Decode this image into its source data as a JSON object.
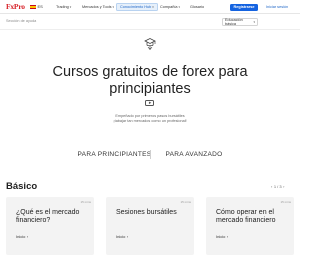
{
  "nav": {
    "logo": "FxPro",
    "lang": "ES",
    "items": [
      {
        "label": "Trading",
        "dropdown": true
      },
      {
        "label": "Mercados y Tools",
        "dropdown": true
      },
      {
        "label": "Conocimiento Hub",
        "dropdown": true,
        "active": true
      },
      {
        "label": "Compañía",
        "dropdown": true
      },
      {
        "label": "Glosario",
        "dropdown": false
      }
    ],
    "register": "Registrarse",
    "login": "Iniciar sesión"
  },
  "search": {
    "placeholder": "Sección de ayuda",
    "select_value": "Educación básica"
  },
  "hero": {
    "title_line1": "Cursos gratuitos de forex para",
    "title_line2": "principiantes",
    "subtitle_line1": "Empeñado por primeros pasos bursátiles",
    "subtitle_line2": "¡tabajar tan mercados como un profesional!"
  },
  "tabs": [
    "PARA PRINCIPIANTES",
    "PARA AVANZADO"
  ],
  "section": {
    "title": "Básico",
    "pager": "1 / 3"
  },
  "cards": [
    {
      "meta": "15 mins",
      "title": "¿Qué es el mercado financiero?",
      "link": "Inicio"
    },
    {
      "meta": "15 mins",
      "title": "Sesiones bursátiles",
      "link": "Inicio"
    },
    {
      "meta": "15 mins",
      "title": "Cómo operar en el mercado financiero",
      "link": "Inicio"
    }
  ],
  "colors": {
    "brand": "#d8232a",
    "accent": "#1463e0"
  }
}
